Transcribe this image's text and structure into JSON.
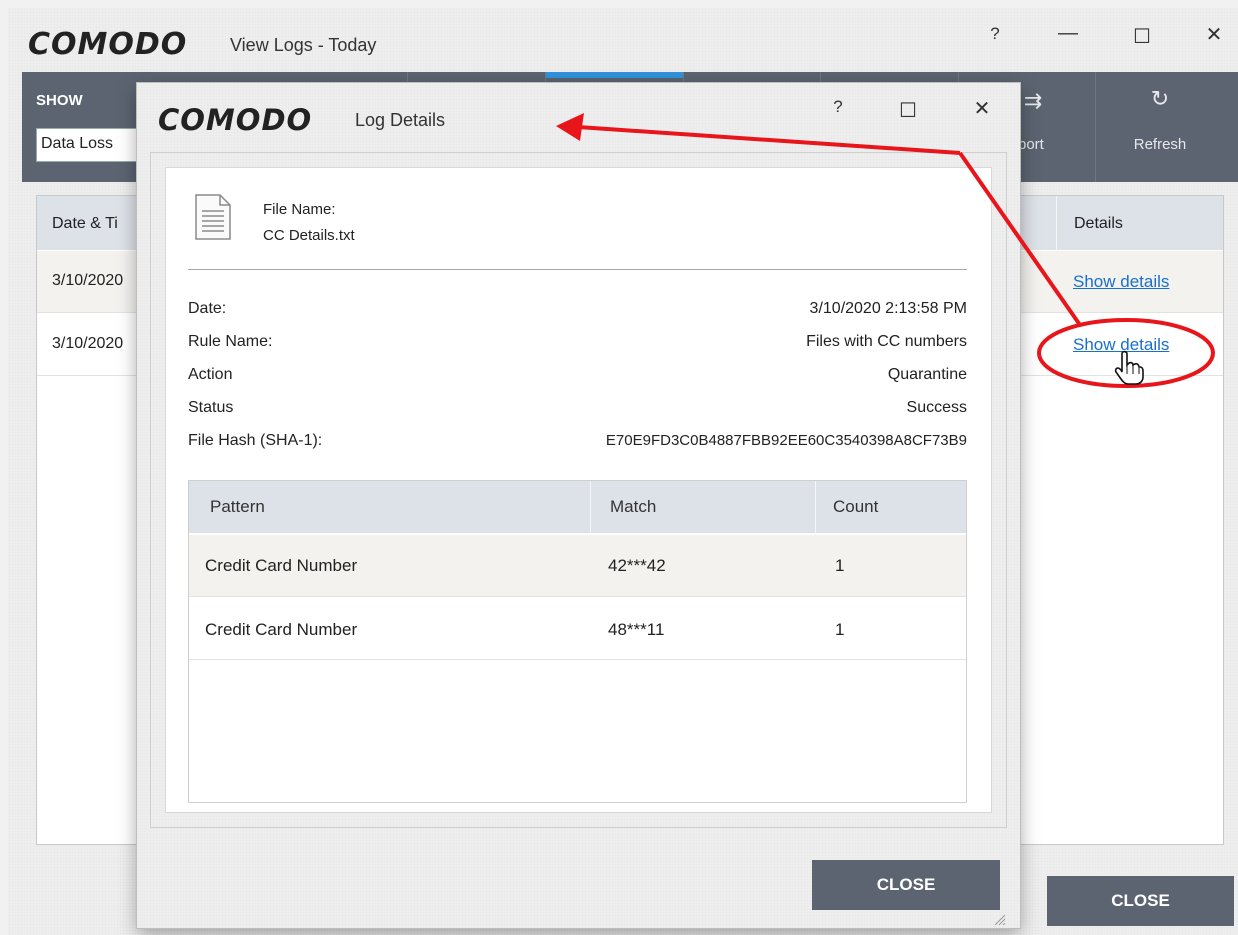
{
  "main_window": {
    "logo": "COMODO",
    "title": "View Logs - Today",
    "controls": {
      "help": "?",
      "minimize": "—",
      "maximize": "☐",
      "close": "✕"
    },
    "toolbar": {
      "show_label": "SHOW",
      "show_value": "Data Loss",
      "export_label": "port",
      "refresh_label": "Refresh"
    },
    "grid": {
      "headers": {
        "date_time": "Date & Ti",
        "details": "Details"
      },
      "rows": [
        {
          "date": "3/10/2020",
          "details_link": "Show details"
        },
        {
          "date": "3/10/2020",
          "details_link": "Show details"
        }
      ]
    },
    "close_button": "CLOSE"
  },
  "dialog": {
    "logo": "COMODO",
    "title": "Log Details",
    "controls": {
      "help": "?",
      "maximize": "☐",
      "close": "✕"
    },
    "file": {
      "label": "File Name:",
      "value": "CC Details.txt"
    },
    "fields": [
      {
        "label": "Date:",
        "value": "3/10/2020 2:13:58 PM"
      },
      {
        "label": "Rule Name:",
        "value": "Files with CC numbers"
      },
      {
        "label": "Action",
        "value": "Quarantine"
      },
      {
        "label": "Status",
        "value": "Success"
      },
      {
        "label": "File Hash (SHA-1):",
        "value": "E70E9FD3C0B4887FBB92EE60C3540398A8CF73B9"
      }
    ],
    "table": {
      "headers": [
        "Pattern",
        "Match",
        "Count"
      ],
      "rows": [
        [
          "Credit Card Number",
          "42***42",
          "1"
        ],
        [
          "Credit Card Number",
          "48***11",
          "1"
        ]
      ]
    },
    "close_button": "CLOSE"
  },
  "annotation": {
    "arrow_color": "#e8151b",
    "highlight_color": "#e8151b"
  }
}
